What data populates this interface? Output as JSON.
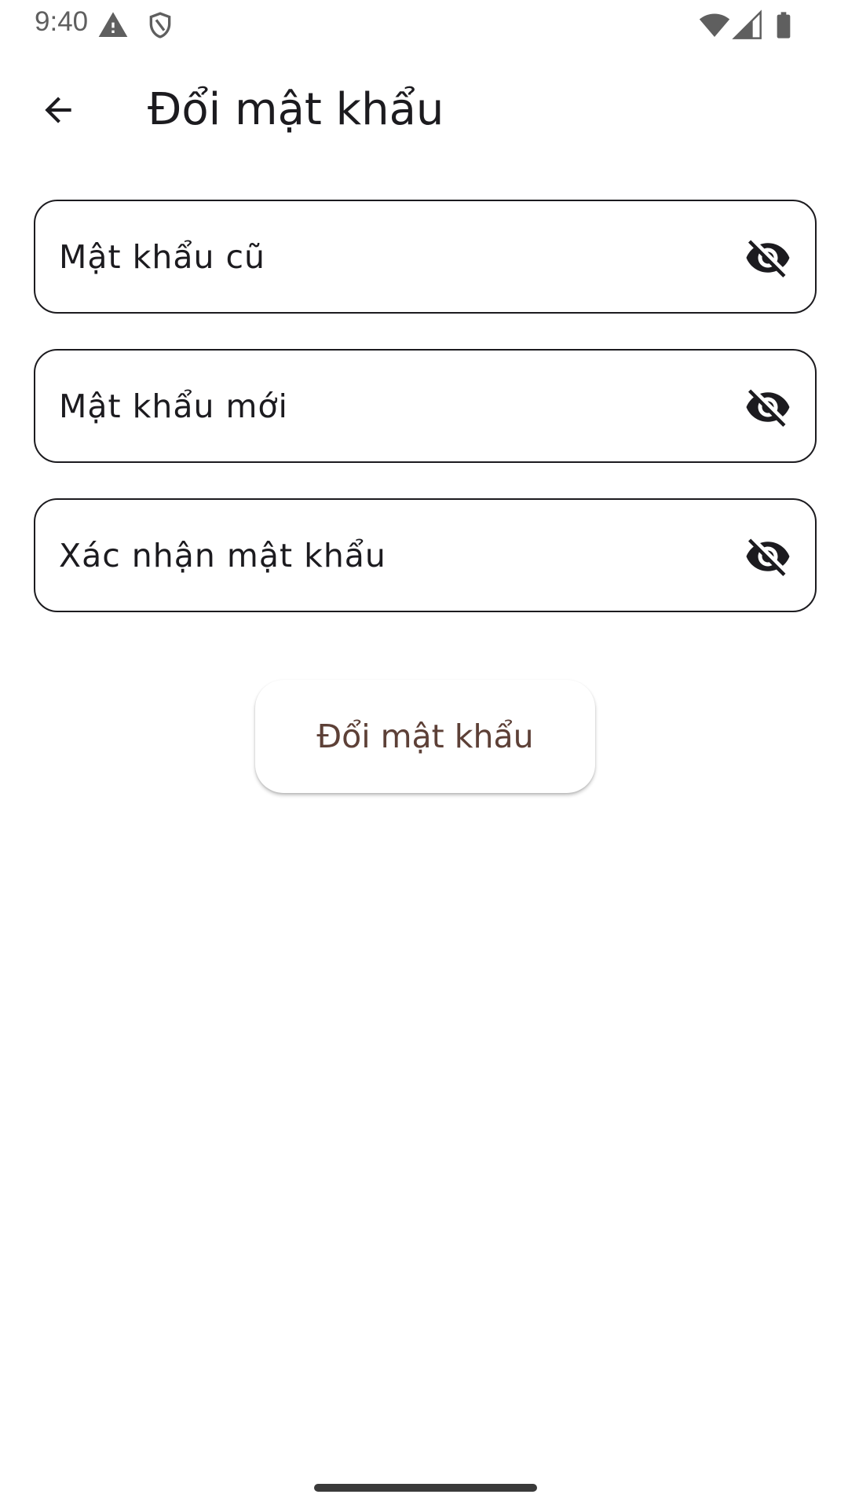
{
  "status_bar": {
    "time": "9:40",
    "icons": [
      "warning-icon",
      "shield-icon",
      "wifi-icon",
      "signal-icon",
      "battery-icon"
    ]
  },
  "app_bar": {
    "back_icon": "arrow-back-icon",
    "title": "Đổi mật khẩu"
  },
  "form": {
    "fields": [
      {
        "label": "Mật khẩu cũ",
        "toggle_icon": "visibility-off-icon"
      },
      {
        "label": "Mật khẩu mới",
        "toggle_icon": "visibility-off-icon"
      },
      {
        "label": "Xác nhận mật khẩu",
        "toggle_icon": "visibility-off-icon"
      }
    ],
    "submit_label": "Đổi mật khẩu"
  },
  "colors": {
    "text": "#1c1b1f",
    "button_text": "#5d4037",
    "status_text": "#5f5f5f"
  }
}
